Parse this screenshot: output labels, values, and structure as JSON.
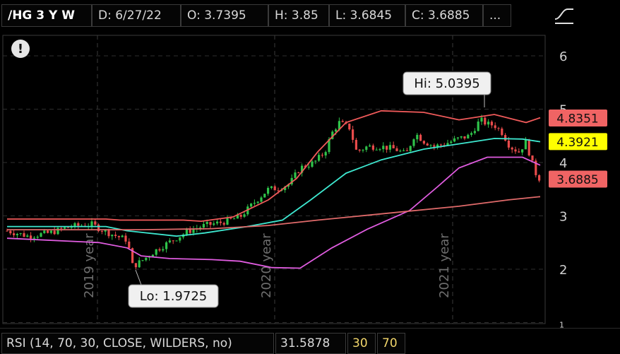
{
  "header": {
    "symbol": "/HG 3 Y W",
    "date": "D: 6/27/22",
    "open": "O: 3.7395",
    "high": "H: 3.85",
    "low": "L: 3.6845",
    "close": "C: 3.6885",
    "more": "..."
  },
  "alert_icon": "!",
  "study_icon": "study-curve-icon",
  "chart_data": {
    "type": "candlestick",
    "y_axis": {
      "range": [
        1,
        6.5
      ],
      "ticks": [
        "6",
        "5",
        "4",
        "3",
        "2",
        "1"
      ]
    },
    "x_axis": {
      "year_labels": [
        "2019 year",
        "2020 year",
        "2021 year"
      ]
    },
    "grid": true,
    "hi_label": "Hi: 5.0395",
    "lo_label": "Lo: 1.9725",
    "price_tags": [
      {
        "text": "4.8351",
        "value": 4.8351,
        "color": "#f06464"
      },
      {
        "text": "4.3921",
        "value": 4.3921,
        "color": "#ffff00"
      },
      {
        "text": "3.6885",
        "value": 3.6885,
        "color": "#f06464"
      }
    ],
    "colors": {
      "up": "#2fc34a",
      "down": "#e84b4b",
      "upper_band": "#f05a5a",
      "middle": "#3ee8d0",
      "lower": "#e05ce0",
      "long_ma": "#e06a6a"
    }
  },
  "footer": {
    "study": "RSI (14, 70, 30, CLOSE, WILDERS, no)",
    "value": "31.5878",
    "oversold": "30",
    "overbought": "70"
  }
}
